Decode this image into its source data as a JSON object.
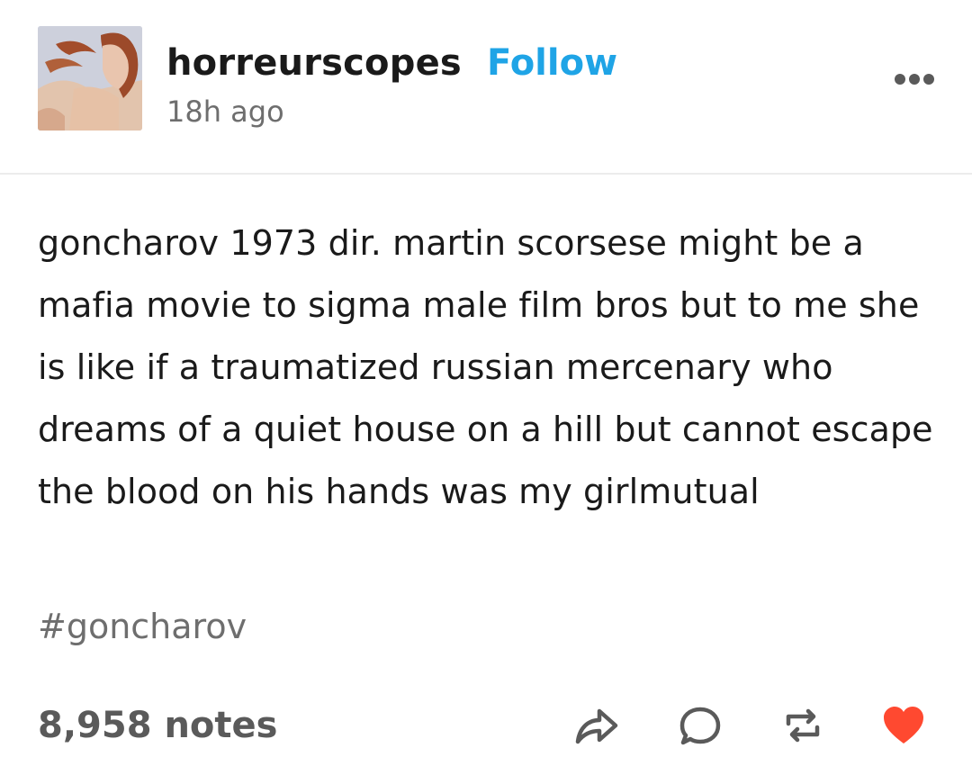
{
  "post": {
    "username": "horreurscopes",
    "follow_label": "Follow",
    "time_ago": "18h ago",
    "body": "goncharov 1973 dir. martin scorsese might be a mafia movie to sigma male film bros but to me she is like if a traumatized russian mercenary who dreams of a quiet house on a hill but cannot escape the blood on his hands was my girlmutual",
    "tag": "#goncharov",
    "notes": "8,958 notes"
  },
  "icons": {
    "more": "more-horizontal-icon",
    "share": "share-arrow-icon",
    "reply": "speech-bubble-icon",
    "reblog": "reblog-icon",
    "like": "heart-icon"
  },
  "colors": {
    "follow": "#1fa4e6",
    "like": "#ff4930",
    "muted": "#6e6e6e"
  }
}
